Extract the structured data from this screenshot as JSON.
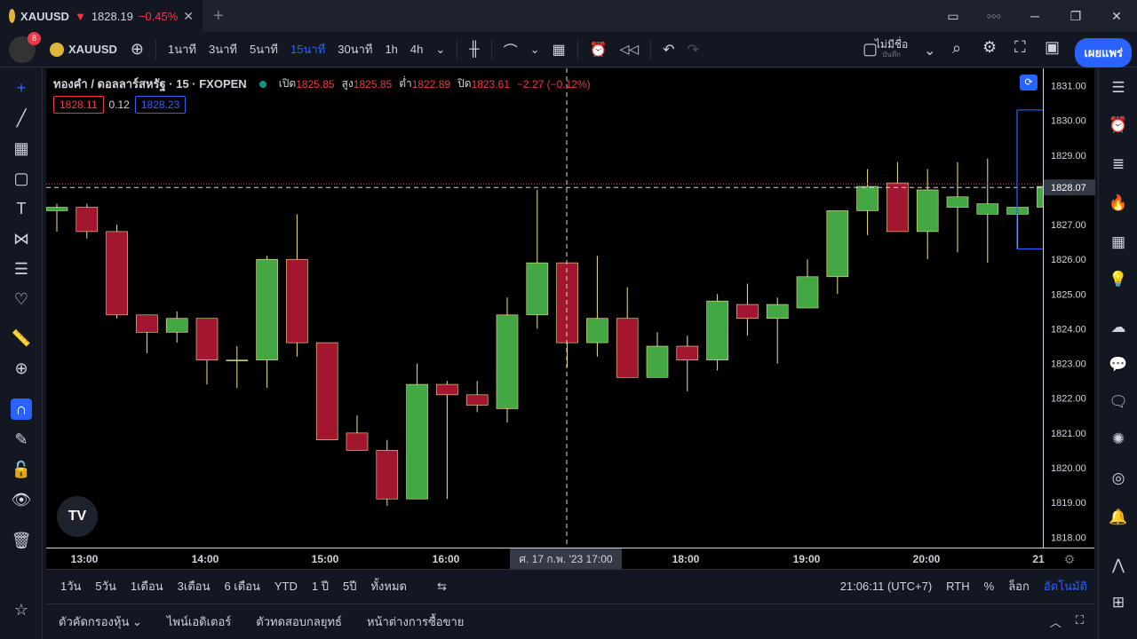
{
  "tab": {
    "symbol": "XAUUSD",
    "arrow": "▼",
    "price": "1828.19",
    "change": "−0.45%",
    "close_icon": "close-icon"
  },
  "window": {
    "minimize": "─",
    "restore": "❐",
    "close": "✕",
    "more": "○○○"
  },
  "toolbar": {
    "notifications_count": "8",
    "symbol": "XAUUSD",
    "timeframes": [
      "1นาที",
      "3นาที",
      "5นาที",
      "15นาที",
      "30นาที",
      "1h",
      "4h"
    ],
    "active_timeframe": "15นาที",
    "layout_name": "ไม่มีชื่อ",
    "layout_sub": "บันทึก",
    "publish_label": "เผยแพร่"
  },
  "legend": {
    "title": "ทองคำ / ดอลลาร์สหรัฐ · 15 · FXOPEN",
    "open_label": "เปิด",
    "open": "1825.85",
    "high_label": "สูง",
    "high": "1825.85",
    "low_label": "ต่ำ",
    "low": "1822.89",
    "close_label": "ปิด",
    "close": "1823.61",
    "change": "−2.27 (−0.12%)",
    "bid": "1828.11",
    "spread": "0.12",
    "ask": "1828.23"
  },
  "price_axis": {
    "ticks": [
      "1831.00",
      "1830.00",
      "1829.00",
      "1828.00",
      "1827.00",
      "1826.00",
      "1825.00",
      "1824.00",
      "1823.00",
      "1822.00",
      "1821.00",
      "1820.00",
      "1819.00",
      "1818.00"
    ],
    "crosshair_label": "1828.07"
  },
  "time_axis": {
    "ticks": [
      "13:00",
      "14:00",
      "15:00",
      "16:00",
      "18:00",
      "19:00",
      "20:00",
      "21"
    ],
    "crosshair_label": "ศ. 17 ก.พ. '23   17:00"
  },
  "bottombar": {
    "ranges": [
      "1วัน",
      "5วัน",
      "1เดือน",
      "3เดือน",
      "6 เดือน",
      "YTD",
      "1 ปี",
      "5ปี",
      "ทั้งหมด"
    ],
    "clock": "21:06:11 (UTC+7)",
    "session": "RTH",
    "percent": "%",
    "log": "ล็อก",
    "auto": "อัตโนมัติ"
  },
  "panelbar": {
    "items": [
      "ตัวคัดกรองหุ้น",
      "ไพน์เอดิเตอร์",
      "ตัวทดสอบกลยุทธ์",
      "หน้าต่างการซื้อขาย"
    ]
  },
  "colors": {
    "up": "#43a843",
    "down": "#a3162f",
    "wick": "#f0e68c",
    "accent": "#2962ff"
  },
  "chart_data": {
    "type": "candlestick",
    "symbol": "XAUUSD",
    "interval": "15",
    "ylim": [
      1817.7,
      1831.5
    ],
    "candles": [
      {
        "o": 1827.4,
        "h": 1827.6,
        "l": 1826.8,
        "c": 1827.5
      },
      {
        "o": 1827.5,
        "h": 1827.6,
        "l": 1826.6,
        "c": 1826.8
      },
      {
        "o": 1826.8,
        "h": 1827.0,
        "l": 1824.3,
        "c": 1824.4
      },
      {
        "o": 1824.4,
        "h": 1824.4,
        "l": 1823.3,
        "c": 1823.9
      },
      {
        "o": 1823.9,
        "h": 1824.5,
        "l": 1823.6,
        "c": 1824.3
      },
      {
        "o": 1824.3,
        "h": 1824.3,
        "l": 1822.4,
        "c": 1823.1
      },
      {
        "o": 1823.1,
        "h": 1823.5,
        "l": 1822.3,
        "c": 1823.1
      },
      {
        "o": 1823.1,
        "h": 1826.1,
        "l": 1822.3,
        "c": 1826.0
      },
      {
        "o": 1826.0,
        "h": 1827.3,
        "l": 1823.2,
        "c": 1823.6
      },
      {
        "o": 1823.6,
        "h": 1823.6,
        "l": 1820.8,
        "c": 1820.8
      },
      {
        "o": 1821.0,
        "h": 1821.5,
        "l": 1820.5,
        "c": 1820.5
      },
      {
        "o": 1820.5,
        "h": 1820.8,
        "l": 1818.9,
        "c": 1819.1
      },
      {
        "o": 1819.1,
        "h": 1823.0,
        "l": 1819.1,
        "c": 1822.4
      },
      {
        "o": 1822.4,
        "h": 1822.5,
        "l": 1819.1,
        "c": 1822.1
      },
      {
        "o": 1822.1,
        "h": 1822.5,
        "l": 1821.6,
        "c": 1821.8
      },
      {
        "o": 1821.7,
        "h": 1824.9,
        "l": 1821.3,
        "c": 1824.4
      },
      {
        "o": 1824.4,
        "h": 1828.0,
        "l": 1824.0,
        "c": 1825.9
      },
      {
        "o": 1825.9,
        "h": 1825.9,
        "l": 1822.9,
        "c": 1823.6
      },
      {
        "o": 1823.6,
        "h": 1826.1,
        "l": 1823.2,
        "c": 1824.3
      },
      {
        "o": 1824.3,
        "h": 1825.2,
        "l": 1822.6,
        "c": 1822.6
      },
      {
        "o": 1822.6,
        "h": 1823.9,
        "l": 1822.6,
        "c": 1823.5
      },
      {
        "o": 1823.5,
        "h": 1823.8,
        "l": 1822.2,
        "c": 1823.1
      },
      {
        "o": 1823.1,
        "h": 1825.0,
        "l": 1822.8,
        "c": 1824.8
      },
      {
        "o": 1824.7,
        "h": 1825.3,
        "l": 1823.8,
        "c": 1824.3
      },
      {
        "o": 1824.3,
        "h": 1824.9,
        "l": 1823.0,
        "c": 1824.7
      },
      {
        "o": 1824.6,
        "h": 1826.0,
        "l": 1824.6,
        "c": 1825.5
      },
      {
        "o": 1825.5,
        "h": 1827.4,
        "l": 1825.0,
        "c": 1827.4
      },
      {
        "o": 1827.4,
        "h": 1828.6,
        "l": 1826.7,
        "c": 1828.1
      },
      {
        "o": 1828.2,
        "h": 1828.8,
        "l": 1826.8,
        "c": 1826.8
      },
      {
        "o": 1826.8,
        "h": 1828.6,
        "l": 1826.0,
        "c": 1828.0
      },
      {
        "o": 1827.5,
        "h": 1828.8,
        "l": 1826.2,
        "c": 1827.8
      },
      {
        "o": 1827.3,
        "h": 1828.9,
        "l": 1825.9,
        "c": 1827.6
      },
      {
        "o": 1827.3,
        "h": 1827.5,
        "l": 1826.3,
        "c": 1827.5
      },
      {
        "o": 1827.5,
        "h": 1828.2,
        "l": 1826.8,
        "c": 1828.1
      }
    ],
    "hline": 1828.07
  }
}
